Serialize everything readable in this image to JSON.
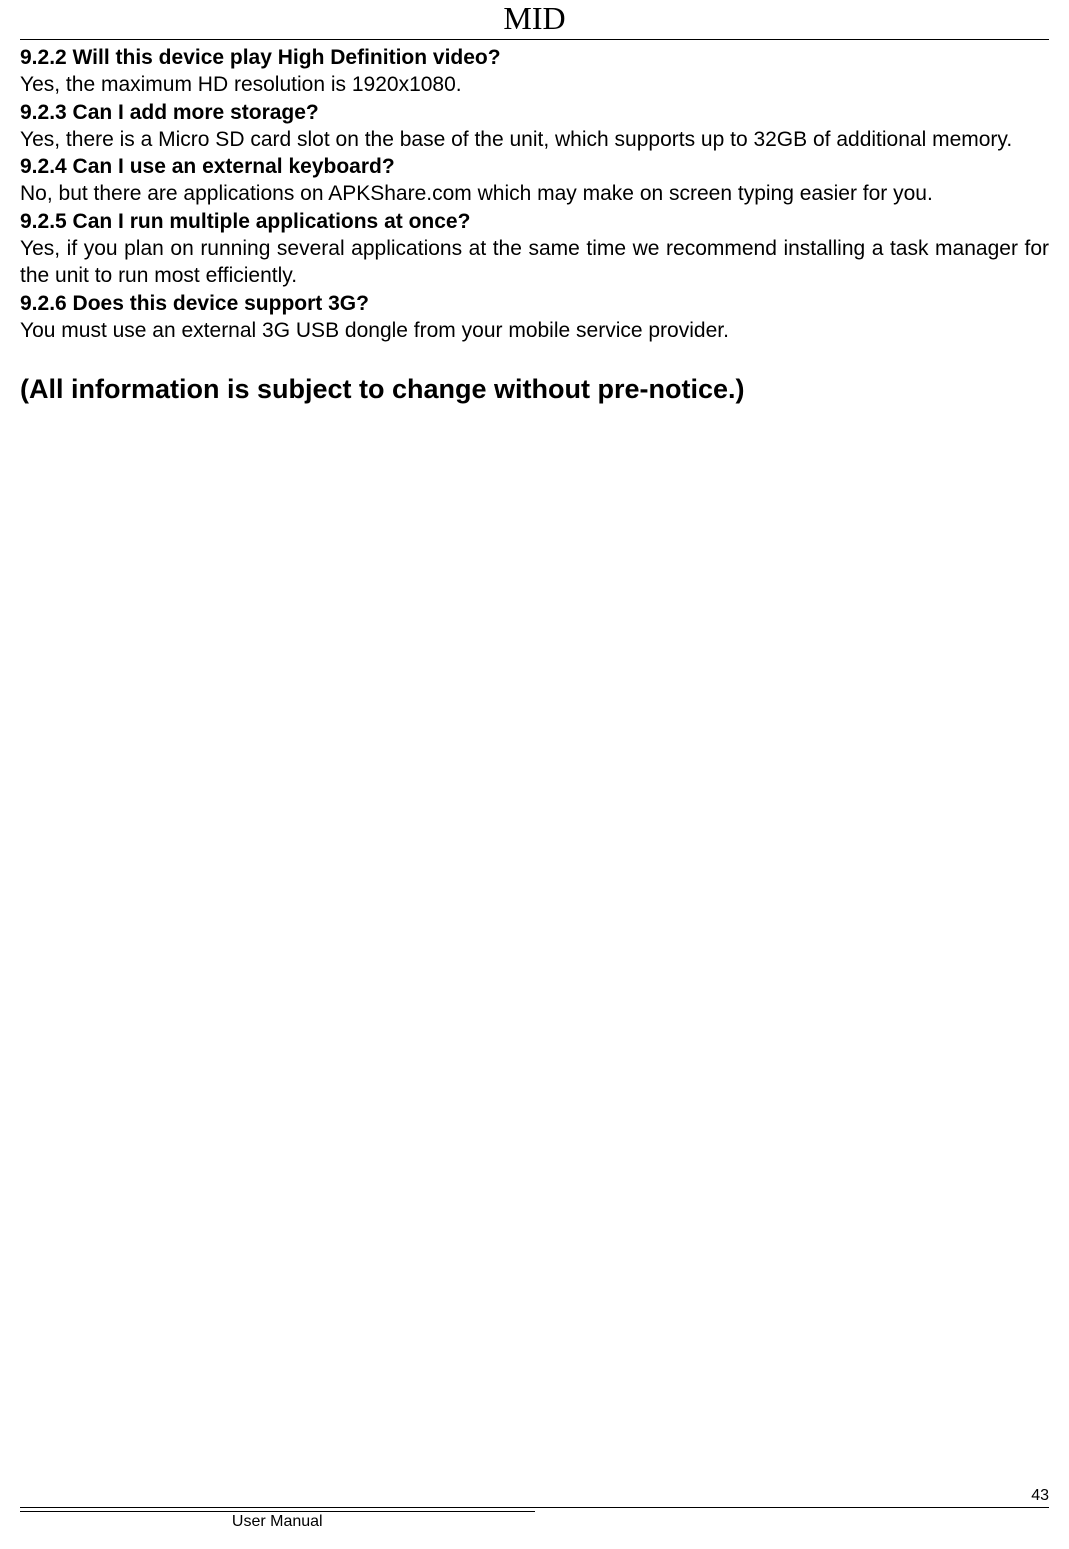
{
  "header": {
    "title": "MID"
  },
  "content": {
    "faqs": [
      {
        "question": "9.2.2 Will this device play High Definition video?",
        "answer": "Yes, the maximum HD resolution is 1920x1080."
      },
      {
        "question": "9.2.3 Can I add more storage?",
        "answer": "Yes, there is a Micro SD card slot on the base of the unit, which supports up to 32GB of additional memory."
      },
      {
        "question": "9.2.4 Can I use an external keyboard?",
        "answer": "No, but there are applications on APKShare.com which may make on screen typing easier for you."
      },
      {
        "question": "9.2.5 Can I run multiple applications at once?",
        "answer": "Yes, if you plan on running several applications at the same time we recommend installing a task manager for the unit to run most efficiently."
      },
      {
        "question": "9.2.6 Does this device support 3G?",
        "answer": "You must use an external 3G USB dongle from your mobile service provider."
      }
    ],
    "notice": "(All information is subject to change without pre-notice.)"
  },
  "footer": {
    "text": "User Manual",
    "page_number": "43"
  }
}
